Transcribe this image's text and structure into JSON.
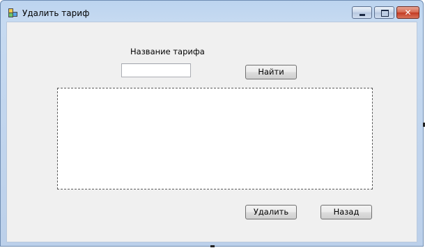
{
  "window": {
    "title": "Удалить тариф"
  },
  "form": {
    "tariff_name_label": "Название тарифа",
    "tariff_name_value": "",
    "find_button": "Найти",
    "delete_button": "Удалить",
    "back_button": "Назад"
  },
  "results_list": {
    "items": []
  },
  "colors": {
    "client_background": "#f0f0f0",
    "frame": "#bcd4ef",
    "close_button": "#c23a23"
  }
}
